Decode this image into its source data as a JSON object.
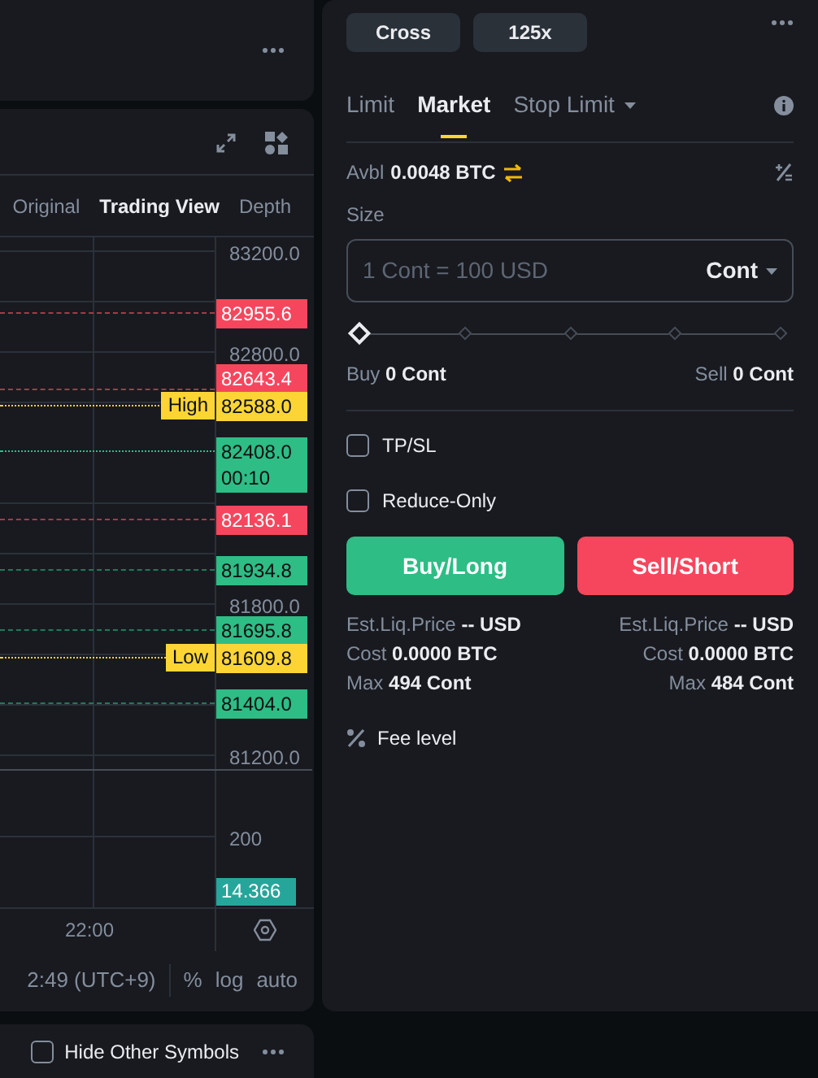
{
  "chart": {
    "view_tabs": [
      {
        "label": "Original",
        "selected": false
      },
      {
        "label": "Trading View",
        "selected": true
      },
      {
        "label": "Depth",
        "selected": false
      }
    ],
    "price_axis": [
      "83200.0",
      "82800.0",
      "81800.0",
      "81200.0"
    ],
    "volume_axis": [
      "200"
    ],
    "price_tags": [
      {
        "value": "82955.6",
        "kind": "sell"
      },
      {
        "value": "82643.4",
        "kind": "sell"
      },
      {
        "value": "82588.0",
        "kind": "high",
        "label": "High"
      },
      {
        "value": "82408.0",
        "kind": "last",
        "countdown": "00:10"
      },
      {
        "value": "82136.1",
        "kind": "sell"
      },
      {
        "value": "81934.8",
        "kind": "buy"
      },
      {
        "value": "81695.8",
        "kind": "buy"
      },
      {
        "value": "81609.8",
        "kind": "low",
        "label": "Low"
      },
      {
        "value": "81404.0",
        "kind": "buy"
      }
    ],
    "volume_tag": "14.366",
    "time_axis": [
      "22:00"
    ],
    "toolbar": {
      "time": "2:49 (UTC+9)",
      "percent": "%",
      "log": "log",
      "auto": "auto"
    }
  },
  "hide_other_symbols": {
    "label": "Hide Other Symbols",
    "checked": false
  },
  "order_panel": {
    "margin_mode": "Cross",
    "leverage": "125x",
    "order_tabs": [
      {
        "label": "Limit",
        "selected": false,
        "dropdown": false
      },
      {
        "label": "Market",
        "selected": true,
        "dropdown": false
      },
      {
        "label": "Stop Limit",
        "selected": false,
        "dropdown": true
      }
    ],
    "available": {
      "label": "Avbl",
      "value": "0.0048 BTC"
    },
    "size_label": "Size",
    "size_field": {
      "placeholder": "1 Cont = 100 USD",
      "unit": "Cont"
    },
    "slider": {
      "level": 0
    },
    "buy_amount": {
      "label": "Buy",
      "value": "0 Cont"
    },
    "sell_amount": {
      "label": "Sell",
      "value": "0 Cont"
    },
    "options": [
      {
        "label": "TP/SL",
        "checked": false
      },
      {
        "label": "Reduce-Only",
        "checked": false
      }
    ],
    "buy_button": "Buy/Long",
    "sell_button": "Sell/Short",
    "buy_summary": [
      {
        "label": "Est.Liq.Price",
        "value": "-- USD"
      },
      {
        "label": "Cost",
        "value": "0.0000 BTC"
      },
      {
        "label": "Max",
        "value": "494 Cont"
      }
    ],
    "sell_summary": [
      {
        "label": "Est.Liq.Price",
        "value": "-- USD"
      },
      {
        "label": "Cost",
        "value": "0.0000 BTC"
      },
      {
        "label": "Max",
        "value": "484 Cont"
      }
    ],
    "fee_level": "Fee level"
  }
}
